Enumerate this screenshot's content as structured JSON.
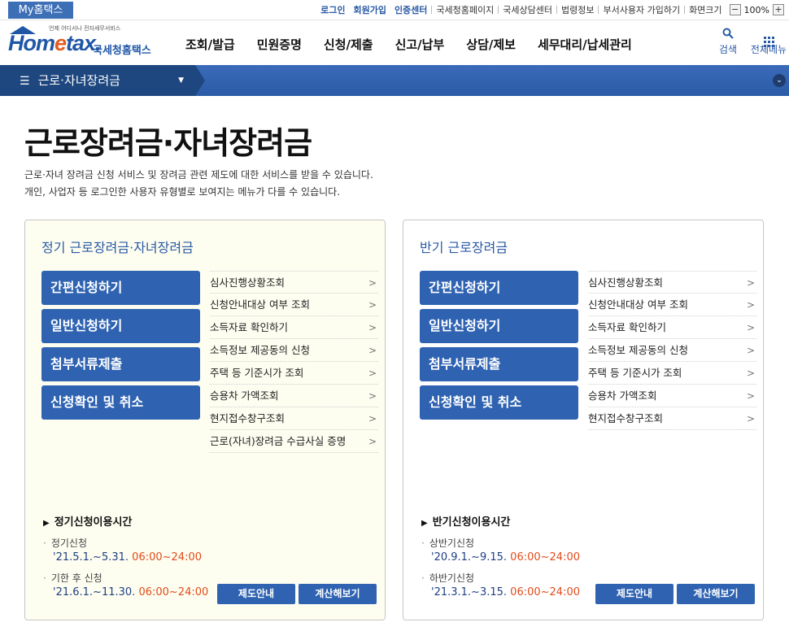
{
  "util": {
    "my_home": "My홈택스",
    "links": [
      "로그인",
      "회원가입",
      "인증센터",
      "국세청홈페이지",
      "국세상담센터",
      "법령정보",
      "부서사용자 가입하기"
    ],
    "zoom_label": "화면크기",
    "zoom_minus": "−",
    "zoom_value": "100%",
    "zoom_plus": "+"
  },
  "header": {
    "logo_tagline": "언제 어디서나 전자세무서비스",
    "logo_text_a": "Hom",
    "logo_text_e": "e",
    "logo_text_b": "tax.",
    "logo_kr": "국세청홈택스",
    "menu": [
      "조회/발급",
      "민원증명",
      "신청/제출",
      "신고/납부",
      "상담/제보",
      "세무대리/납세관리"
    ],
    "search_label": "검색",
    "allmenu_label": "전체메뉴"
  },
  "navbar": {
    "selected": "근로·자녀장려금",
    "hamburger": "☰",
    "dropdown": "▼",
    "toggle": "⌄"
  },
  "page": {
    "title": "근로장려금·자녀장려금",
    "desc1": "근로·자녀 장려금 신청 서비스 및 장려금 관련 제도에 대한 서비스를 받을 수 있습니다.",
    "desc2": "개인, 사업자 등 로그인한 사용자 유형별로 보여지는 메뉴가 다를 수 있습니다."
  },
  "panel1": {
    "title": "정기 근로장려금·자녀장려금",
    "buttons": [
      "간편신청하기",
      "일반신청하기",
      "첨부서류제출",
      "신청확인 및 취소"
    ],
    "links": [
      "심사진행상황조회",
      "신청안내대상 여부 조회",
      "소득자료 확인하기",
      "소득정보 제공동의 신청",
      "주택 등 기준시가 조회",
      "승용차 가액조회",
      "현지접수창구조회",
      "근로(자녀)장려금 수급사실 증명"
    ],
    "schedule_title": "정기신청이용시간",
    "schedule": [
      {
        "label": "정기신청",
        "date": "'21.5.1.~5.31.",
        "time": "06:00~24:00"
      },
      {
        "label": "기한 후 신청",
        "date": "'21.6.1.~11.30.",
        "time": "06:00~24:00"
      }
    ],
    "btn_info": "제도안내",
    "btn_calc": "계산해보기"
  },
  "panel2": {
    "title": "반기 근로장려금",
    "buttons": [
      "간편신청하기",
      "일반신청하기",
      "첨부서류제출",
      "신청확인 및 취소"
    ],
    "links": [
      "심사진행상황조회",
      "신청안내대상 여부 조회",
      "소득자료 확인하기",
      "소득정보 제공동의 신청",
      "주택 등 기준시가 조회",
      "승용차 가액조회",
      "현지접수창구조회"
    ],
    "schedule_title": "반기신청이용시간",
    "schedule": [
      {
        "label": "상반기신청",
        "date": "'20.9.1.~9.15.",
        "time": "06:00~24:00"
      },
      {
        "label": "하반기신청",
        "date": "'21.3.1.~3.15.",
        "time": "06:00~24:00"
      }
    ],
    "btn_info": "제도안내",
    "btn_calc": "계산해보기"
  }
}
